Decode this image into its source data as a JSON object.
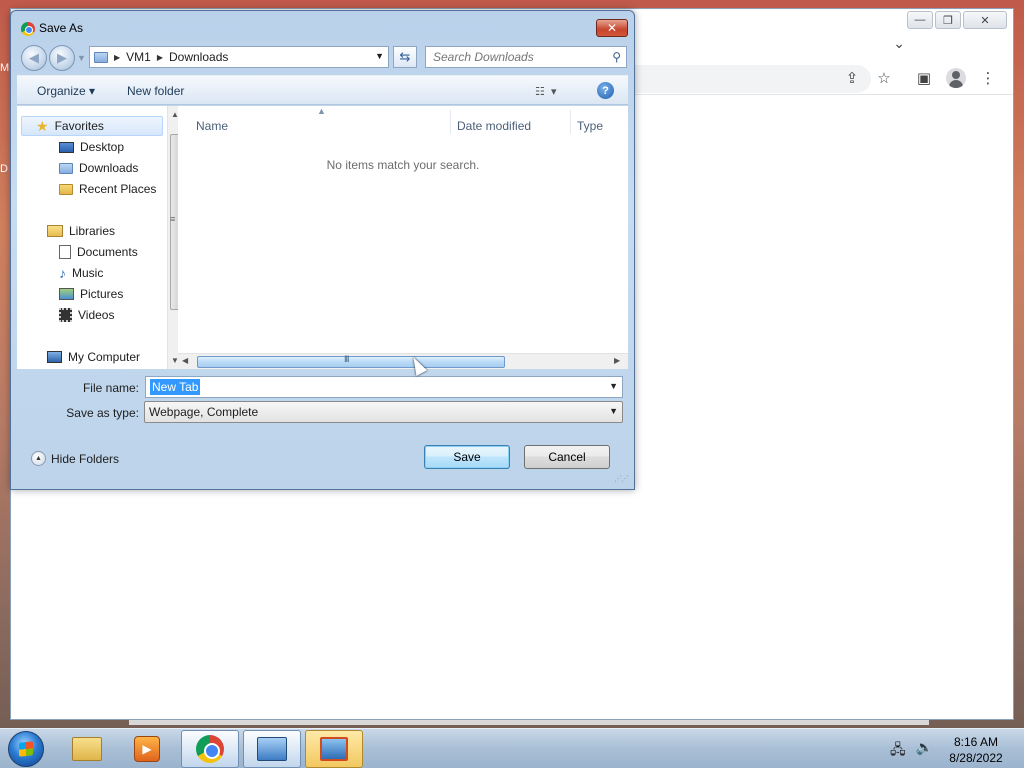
{
  "browser": {
    "window_controls": {
      "minimize": "—",
      "restore": "❐",
      "close": "✕"
    }
  },
  "dialog": {
    "title": "Save As",
    "close_label": "✕",
    "breadcrumb": [
      "VM1",
      "Downloads"
    ],
    "search": {
      "placeholder": "Search Downloads",
      "value": ""
    },
    "commands": {
      "organize": "Organize ▾",
      "new_folder": "New folder"
    },
    "nav": {
      "favorites": "Favorites",
      "desktop": "Desktop",
      "downloads": "Downloads",
      "recent_places": "Recent Places",
      "libraries": "Libraries",
      "documents": "Documents",
      "music": "Music",
      "pictures": "Pictures",
      "videos": "Videos",
      "my_computer": "My Computer"
    },
    "columns": {
      "name": "Name",
      "date_modified": "Date modified",
      "type": "Type"
    },
    "empty_message": "No items match your search.",
    "file_name_label": "File name:",
    "file_name_value": "New Tab",
    "save_type_label": "Save as type:",
    "save_type_value": "Webpage, Complete",
    "hide_folders": "Hide Folders",
    "save_button": "Save",
    "cancel_button": "Cancel"
  },
  "taskbar": {
    "time": "8:16 AM",
    "date": "8/28/2022"
  },
  "colors": {
    "dialog_frame": "#bcd3ea",
    "selection": "#3399ff",
    "taskbar": "#a9bfd6"
  }
}
